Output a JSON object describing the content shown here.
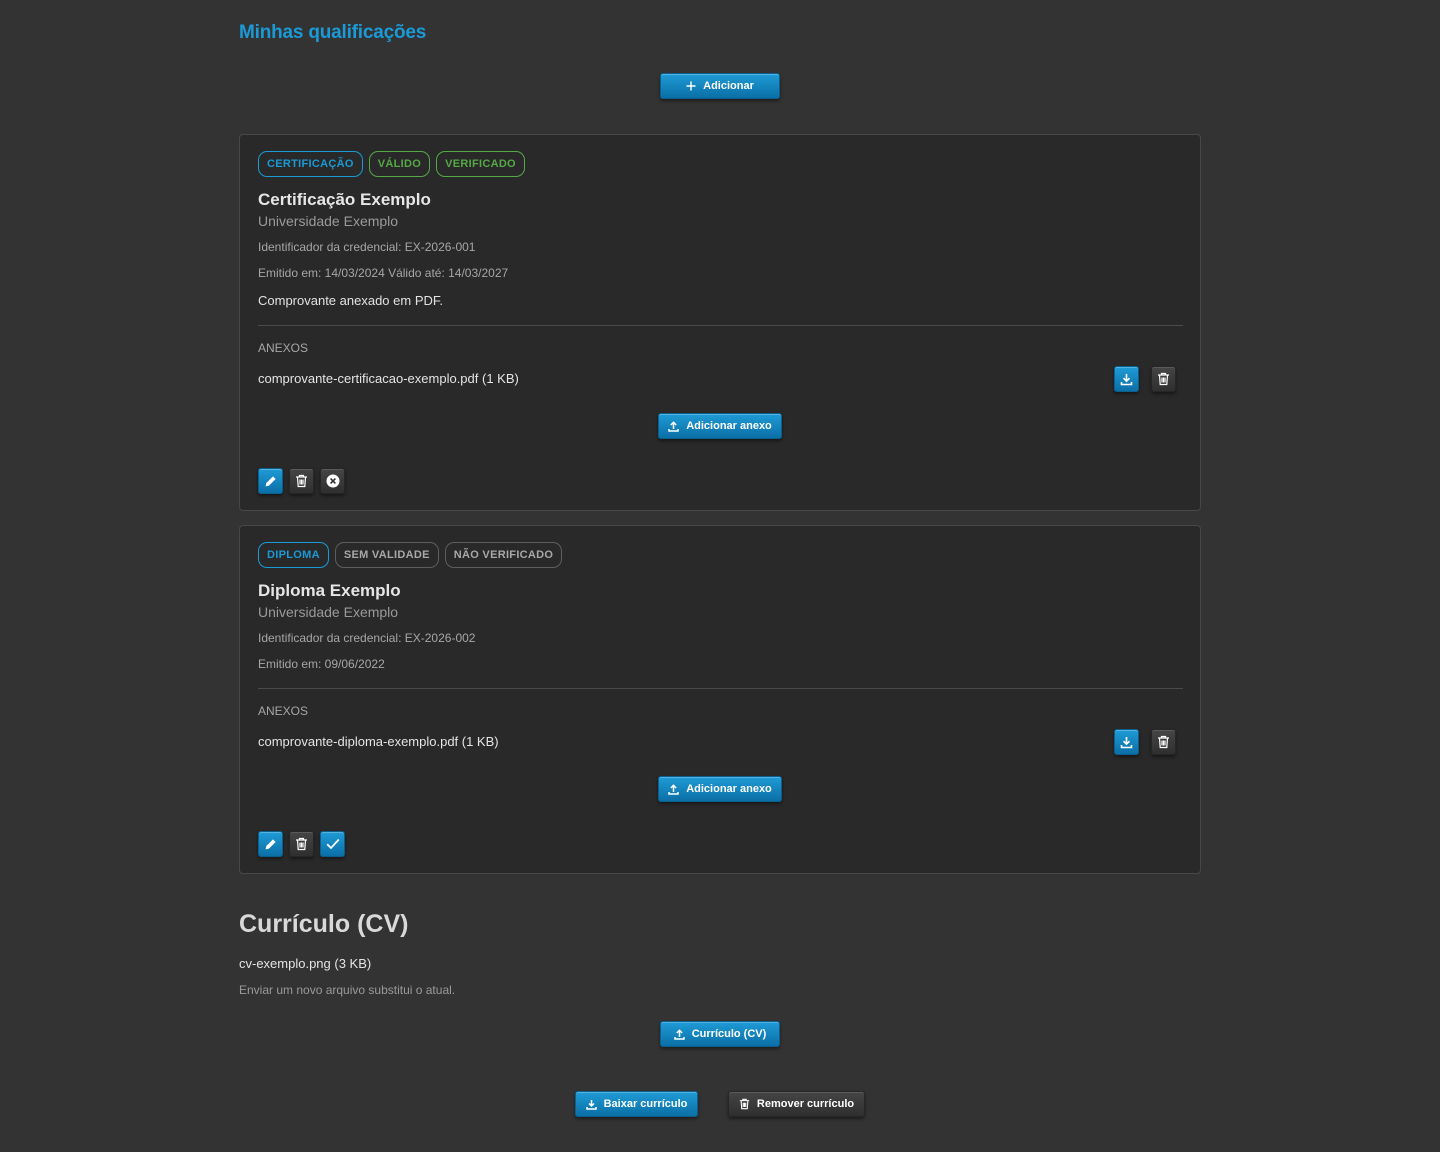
{
  "qualifications_section": {
    "title": "Minhas qualificações",
    "add_label": "Adicionar"
  },
  "qualifications": [
    {
      "badges": [
        "CERTIFICAÇÃO",
        "VÁLIDO",
        "VERIFICADO"
      ],
      "title": "Certificação Exemplo",
      "institution": "Universidade Exemplo",
      "credential_id": "Identificador da credencial: EX-2026-001",
      "dates": "Emitido em: 14/03/2024 Válido até: 14/03/2027",
      "note": "Comprovante anexado em PDF.",
      "attachments_label": "ANEXOS",
      "attachment": "comprovante-certificacao-exemplo.pdf (1 KB)",
      "add_attachment_label": "Adicionar anexo",
      "status_action": "unverify"
    },
    {
      "badges": [
        "DIPLOMA",
        "SEM VALIDADE",
        "NÃO VERIFICADO"
      ],
      "title": "Diploma Exemplo",
      "institution": "Universidade Exemplo",
      "credential_id": "Identificador da credencial: EX-2026-002",
      "dates": "Emitido em: 09/06/2022",
      "attachments_label": "ANEXOS",
      "attachment": "comprovante-diploma-exemplo.pdf (1 KB)",
      "add_attachment_label": "Adicionar anexo",
      "status_action": "verify"
    }
  ],
  "cv": {
    "title": "Currículo (CV)",
    "file": "cv-exemplo.png (3 KB)",
    "hint": "Enviar um novo arquivo substitui o atual.",
    "upload_label": "Currículo (CV)",
    "download_label": "Baixar currículo",
    "remove_label": "Remover currículo"
  },
  "colors": {
    "accent": "#1a9ad6",
    "valid_green": "#55a846",
    "background": "#333333",
    "card_background": "#292929"
  }
}
